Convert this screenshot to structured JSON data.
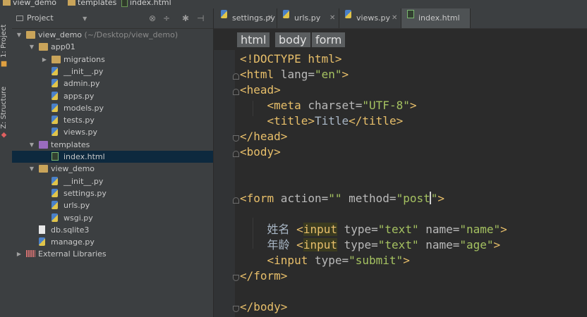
{
  "top_breadcrumb": {
    "project": "view_demo",
    "folder": "templates",
    "file": "index.html"
  },
  "side_tabs": {
    "project": "1: Project",
    "structure": "Z: Structure"
  },
  "project_panel": {
    "selector": "Project"
  },
  "tree": [
    {
      "label": "view_demo",
      "hint": "(~/Desktop/view_demo)",
      "depth": 0,
      "icon": "folder",
      "expanded": true
    },
    {
      "label": "app01",
      "depth": 1,
      "icon": "folder",
      "expanded": true
    },
    {
      "label": "migrations",
      "depth": 2,
      "icon": "folder",
      "expanded": false
    },
    {
      "label": "__init__.py",
      "depth": 2,
      "icon": "py"
    },
    {
      "label": "admin.py",
      "depth": 2,
      "icon": "py"
    },
    {
      "label": "apps.py",
      "depth": 2,
      "icon": "py"
    },
    {
      "label": "models.py",
      "depth": 2,
      "icon": "py"
    },
    {
      "label": "tests.py",
      "depth": 2,
      "icon": "py"
    },
    {
      "label": "views.py",
      "depth": 2,
      "icon": "py"
    },
    {
      "label": "templates",
      "depth": 1,
      "icon": "folder-purple",
      "expanded": true
    },
    {
      "label": "index.html",
      "depth": 2,
      "icon": "html",
      "selected": true
    },
    {
      "label": "view_demo",
      "depth": 1,
      "icon": "folder",
      "expanded": true
    },
    {
      "label": "__init__.py",
      "depth": 2,
      "icon": "py"
    },
    {
      "label": "settings.py",
      "depth": 2,
      "icon": "py"
    },
    {
      "label": "urls.py",
      "depth": 2,
      "icon": "py"
    },
    {
      "label": "wsgi.py",
      "depth": 2,
      "icon": "py"
    },
    {
      "label": "db.sqlite3",
      "depth": 1,
      "icon": "db"
    },
    {
      "label": "manage.py",
      "depth": 1,
      "icon": "py"
    },
    {
      "label": "External Libraries",
      "depth": 0,
      "icon": "lib",
      "expanded": false
    }
  ],
  "tabs": [
    {
      "label": "settings.py",
      "icon": "py"
    },
    {
      "label": "urls.py",
      "icon": "py"
    },
    {
      "label": "views.py",
      "icon": "py"
    },
    {
      "label": "index.html",
      "icon": "html",
      "active": true
    }
  ],
  "breadcrumbs": [
    "html",
    "body",
    "form"
  ],
  "code": {
    "doctype": "<!DOCTYPE html>",
    "html_open": "<html",
    "lang_attr": " lang=",
    "lang_val": "\"en\"",
    "gt": ">",
    "head_open": "<head>",
    "meta_open": "<meta",
    "charset_attr": " charset=",
    "charset_val": "\"UTF-8\"",
    "title_open": "<title>",
    "title_text": "Title",
    "title_close": "</title>",
    "head_close": "</head>",
    "body_open": "<body>",
    "form_open": "<form",
    "action_attr": " action=",
    "action_val": "\"\"",
    "method_attr": " method=",
    "method_val": "\"post",
    "method_val_end": "\"",
    "label_name": "姓名 ",
    "label_age": "年龄 ",
    "input_lt": "<",
    "input_kw": "input",
    "type_attr": " type=",
    "text_val": "\"text\"",
    "name_attr": " name=",
    "name_val1": "\"name\"",
    "name_val2": "\"age\"",
    "input_open": "<input",
    "submit_val": "\"submit\"",
    "form_close": "</form>",
    "body_close": "</body>"
  },
  "colors": {
    "tag": "#e8bf6a",
    "string": "#a5c261",
    "attribute": "#bababa",
    "selection": "#0d293e"
  }
}
